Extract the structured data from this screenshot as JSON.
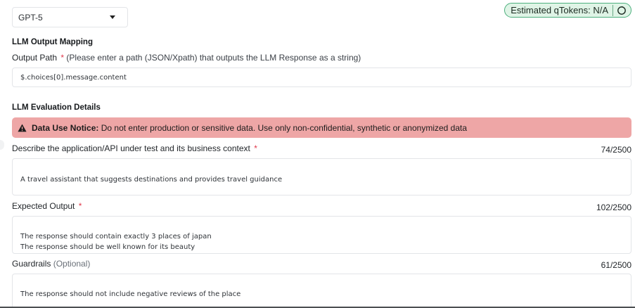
{
  "model_select": {
    "value": "GPT-5"
  },
  "tokens_badge": {
    "label": "Estimated qTokens: N/A"
  },
  "output_mapping": {
    "section_title": "LLM Output Mapping",
    "label": "Output Path",
    "required_mark": "*",
    "hint": "(Please enter a path (JSON/Xpath) that outputs the LLM Response as a string)",
    "value": "$.choices[0].message.content"
  },
  "evaluation": {
    "section_title": "LLM Evaluation Details",
    "notice": {
      "title": "Data Use Notice:",
      "text": "Do not enter production or sensitive data. Use only non-confidential, synthetic or anonymized data"
    },
    "context": {
      "label": "Describe the application/API under test and its business context",
      "required_mark": "*",
      "counter": "74/2500",
      "value": "A travel assistant that suggests destinations and provides travel guidance"
    },
    "expected_output": {
      "label": "Expected Output",
      "required_mark": "*",
      "counter": "102/2500",
      "value": "The response should contain exactly 3 places of japan\nThe response should be well known for its beauty"
    },
    "guardrails": {
      "label": "Guardrails",
      "optional": "(Optional)",
      "counter": "61/2500",
      "value": "The response should not include negative reviews of the place"
    }
  },
  "icons": {
    "dropdown": "chevron-down-icon",
    "refresh": "refresh-icon",
    "warning": "warning-icon"
  },
  "colors": {
    "badge_bg": "#dff4e6",
    "badge_border": "#4caf7d",
    "notice_bg": "#eea6a6",
    "required": "#e0384b"
  }
}
